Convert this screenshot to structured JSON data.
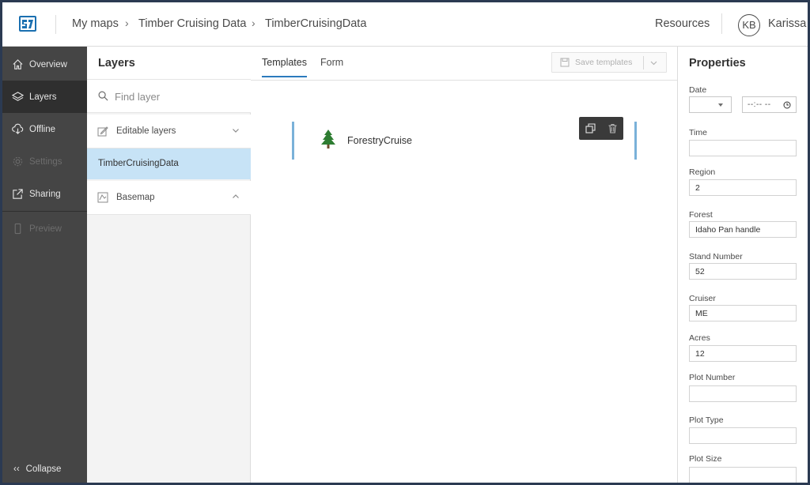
{
  "header": {
    "breadcrumbs": [
      "My maps",
      "Timber Cruising Data",
      "TimberCruisingData"
    ],
    "resources_label": "Resources",
    "user_initials": "KB",
    "user_name": "Karissa"
  },
  "nav": {
    "items": [
      {
        "label": "Overview",
        "icon": "home-icon"
      },
      {
        "label": "Layers",
        "icon": "layers-icon"
      },
      {
        "label": "Offline",
        "icon": "cloud-download-icon"
      },
      {
        "label": "Settings",
        "icon": "gear-icon"
      },
      {
        "label": "Sharing",
        "icon": "share-icon"
      },
      {
        "label": "Preview",
        "icon": "phone-icon"
      }
    ],
    "collapse_label": "Collapse"
  },
  "layers": {
    "title": "Layers",
    "search_placeholder": "Find layer",
    "editable_group": "Editable layers",
    "selected_layer": "TimberCruisingData",
    "basemap_group": "Basemap"
  },
  "main": {
    "tabs": [
      "Templates",
      "Form"
    ],
    "save_label": "Save templates",
    "template_name": "ForestryCruise"
  },
  "properties": {
    "title": "Properties",
    "date_label": "Date",
    "time_placeholder": "--:-- --",
    "fields": [
      {
        "label": "Time",
        "value": ""
      },
      {
        "label": "Region",
        "value": "2"
      },
      {
        "label": "Forest",
        "value": "Idaho Pan handle"
      },
      {
        "label": "Stand Number",
        "value": "52"
      },
      {
        "label": "Cruiser",
        "value": "ME"
      },
      {
        "label": "Acres",
        "value": "12"
      },
      {
        "label": "Plot Number",
        "value": ""
      },
      {
        "label": "Plot Type",
        "value": ""
      },
      {
        "label": "Plot Size",
        "value": ""
      }
    ]
  },
  "colors": {
    "accent": "#2b7bbd",
    "selected_row": "#c7e3f6",
    "nav_bg": "#454545"
  }
}
